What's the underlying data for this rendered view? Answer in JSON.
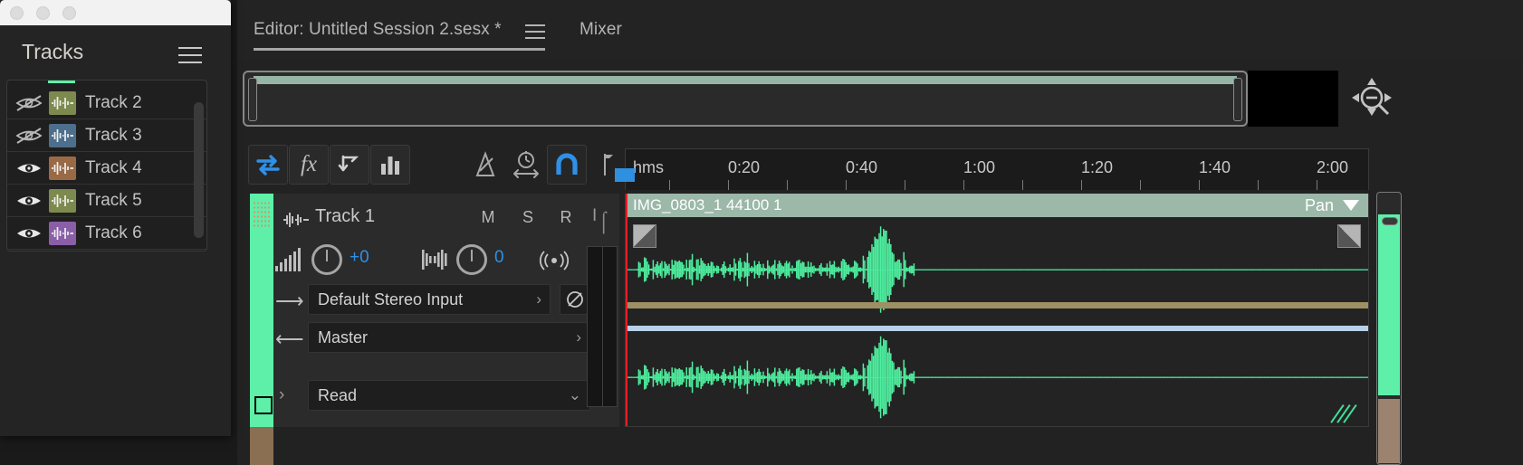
{
  "app": {
    "accent_blue": "#2f90e8",
    "track_green": "#5ef0a8",
    "clip_header_green": "#9bb8a9",
    "playhead_red": "#ee1c25"
  },
  "tabs": {
    "editor_label": "Editor: Untitled Session 2.sesx *",
    "editor_menu_icon": "hamburger-menu-icon",
    "mixer_label": "Mixer"
  },
  "navigator": {
    "zoom_tool_icon": "zoom-out-magnifier-icon"
  },
  "toolbar": {
    "buttons": [
      {
        "name": "routing",
        "icon": "two-way-arrow-icon",
        "active": true
      },
      {
        "name": "effects",
        "icon": "fx-icon",
        "active": false
      },
      {
        "name": "sends",
        "icon": "send-arrow-icon",
        "active": false
      },
      {
        "name": "eq",
        "icon": "bar-chart-icon",
        "active": false
      },
      {
        "name": "metronome",
        "icon": "metronome-icon",
        "active": false
      },
      {
        "name": "time-selection",
        "icon": "stopwatch-arrows-icon",
        "active": false
      },
      {
        "name": "snapping",
        "icon": "magnet-icon",
        "active": true
      },
      {
        "name": "marker",
        "icon": "marker-pin-icon",
        "active": false
      }
    ]
  },
  "ruler": {
    "format_label": "hms",
    "ticks": [
      "0:20",
      "0:40",
      "1:00",
      "1:20",
      "1:40",
      "2:00"
    ]
  },
  "track": {
    "name": "Track 1",
    "wave_icon": "waveform-icon",
    "mute_label": "M",
    "solo_label": "S",
    "record_label": "R",
    "volume_value": "+0",
    "pan_value": "0",
    "volume_icon": "volume-bars-icon",
    "pan_icon": "pan-bars-icon",
    "monitor_icon": "monitor-input-icon",
    "input_label": "Default Stereo Input",
    "output_label": "Master",
    "automation_label": "Read",
    "phase_icon": "phase-invert-icon",
    "input_arrow_icon": "arrow-right-icon",
    "output_arrow_icon": "arrow-left-icon",
    "expand_icon": "chevron-right-icon"
  },
  "clip": {
    "title": "IMG_0803_1 44100 1",
    "envelope_label": "Pan",
    "envelope_caret_icon": "caret-down-icon",
    "fade_in_icon": "fade-in-handle-icon",
    "fade_out_icon": "fade-out-handle-icon",
    "grip_icon": "resize-grip-icon"
  },
  "tracks_panel": {
    "title": "Tracks",
    "menu_icon": "hamburger-menu-icon",
    "window_buttons": [
      "close",
      "minimize",
      "maximize"
    ],
    "rows": [
      {
        "label": "Track 2",
        "visible": false,
        "color": "#7d8a4e",
        "eye_icon": "eye-off-icon"
      },
      {
        "label": "Track 3",
        "visible": false,
        "color": "#4d6f8c",
        "eye_icon": "eye-off-icon"
      },
      {
        "label": "Track 4",
        "visible": true,
        "color": "#9a6a45",
        "eye_icon": "eye-icon"
      },
      {
        "label": "Track 5",
        "visible": true,
        "color": "#7d8a4e",
        "eye_icon": "eye-icon"
      },
      {
        "label": "Track 6",
        "visible": true,
        "color": "#8a5fa8",
        "eye_icon": "eye-icon"
      }
    ]
  }
}
